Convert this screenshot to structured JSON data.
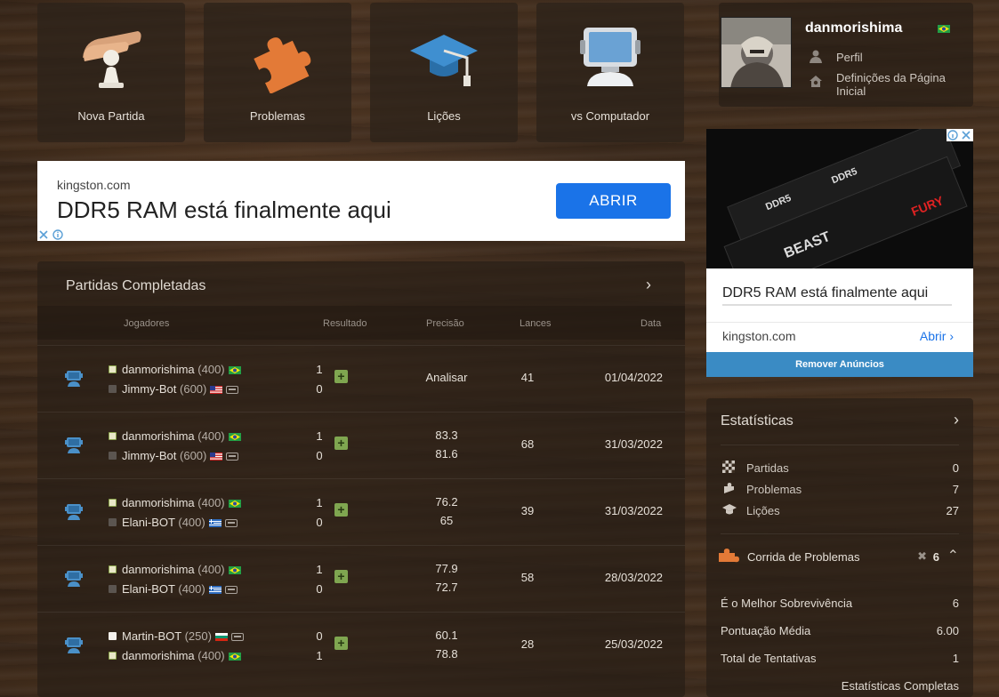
{
  "tiles": [
    {
      "label": "Nova Partida",
      "icon": "pawn-hand-icon"
    },
    {
      "label": "Problemas",
      "icon": "puzzle-piece-icon"
    },
    {
      "label": "Lições",
      "icon": "graduation-cap-icon"
    },
    {
      "label": "vs Computador",
      "icon": "computer-icon"
    }
  ],
  "ad_banner": {
    "domain": "kingston.com",
    "headline": "DDR5 RAM está finalmente aqui",
    "button": "ABRIR"
  },
  "games": {
    "title": "Partidas Completadas",
    "headers": {
      "players": "Jogadores",
      "result": "Resultado",
      "accuracy": "Precisão",
      "moves": "Lances",
      "date": "Data"
    },
    "rows": [
      {
        "p1": {
          "name": "danmorishima",
          "rating": "(400)"
        },
        "p2": {
          "name": "Jimmy-Bot",
          "rating": "(600)"
        },
        "r1": "1",
        "r2": "0",
        "acc1": "Analisar",
        "acc2": "",
        "moves": "41",
        "date": "01/04/2022"
      },
      {
        "p1": {
          "name": "danmorishima",
          "rating": "(400)"
        },
        "p2": {
          "name": "Jimmy-Bot",
          "rating": "(600)"
        },
        "r1": "1",
        "r2": "0",
        "acc1": "83.3",
        "acc2": "81.6",
        "moves": "68",
        "date": "31/03/2022"
      },
      {
        "p1": {
          "name": "danmorishima",
          "rating": "(400)"
        },
        "p2": {
          "name": "Elani-BOT",
          "rating": "(400)"
        },
        "r1": "1",
        "r2": "0",
        "acc1": "76.2",
        "acc2": "65",
        "moves": "39",
        "date": "31/03/2022"
      },
      {
        "p1": {
          "name": "danmorishima",
          "rating": "(400)"
        },
        "p2": {
          "name": "Elani-BOT",
          "rating": "(400)"
        },
        "r1": "1",
        "r2": "0",
        "acc1": "77.9",
        "acc2": "72.7",
        "moves": "58",
        "date": "28/03/2022"
      },
      {
        "p1": {
          "name": "Martin-BOT",
          "rating": "(250)"
        },
        "p2": {
          "name": "danmorishima",
          "rating": "(400)"
        },
        "r1": "0",
        "r2": "1",
        "acc1": "60.1",
        "acc2": "78.8",
        "moves": "28",
        "date": "25/03/2022"
      }
    ]
  },
  "profile": {
    "username": "danmorishima",
    "links": {
      "profile": "Perfil",
      "home_settings": "Definições da Página Inicial"
    }
  },
  "ad_side": {
    "headline": "DDR5 RAM está finalmente aqui",
    "domain": "kingston.com",
    "open": "Abrir",
    "remove": "Remover Anúncios",
    "img_text1": "DDR5",
    "img_text2": "DDR5",
    "img_text3": "BEAST",
    "img_brand": "FURY"
  },
  "stats": {
    "title": "Estatísticas",
    "items": [
      {
        "label": "Partidas",
        "value": "0"
      },
      {
        "label": "Problemas",
        "value": "7"
      },
      {
        "label": "Lições",
        "value": "27"
      }
    ],
    "rush": {
      "label": "Corrida de Problemas",
      "value": "6"
    },
    "rows": [
      {
        "label": "É o Melhor Sobrevivência",
        "value": "6"
      },
      {
        "label": "Pontuação Média",
        "value": "6.00"
      },
      {
        "label": "Total de Tentativas",
        "value": "1"
      }
    ],
    "full_link": "Estatísticas Completas"
  },
  "colors": {
    "accent_blue": "#1a73e8",
    "win_green": "#7fa650",
    "analyze_blue": "#6fa7d8"
  }
}
